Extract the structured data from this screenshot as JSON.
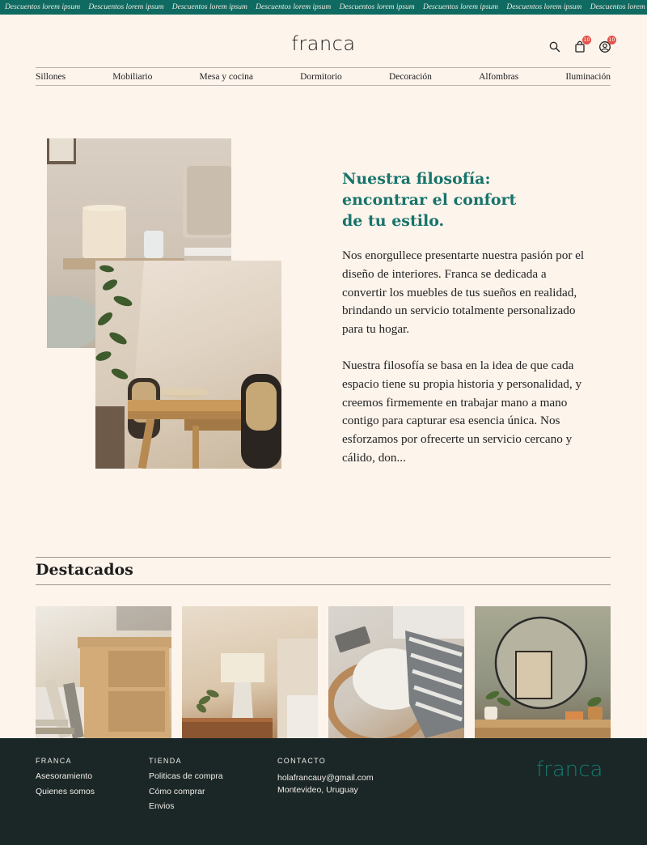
{
  "promo": {
    "text": "Descuentos lorem ipsum",
    "items": [
      "Descuentos lorem ipsum",
      "Descuentos lorem ipsum",
      "Descuentos lorem ipsum",
      "Descuentos lorem ipsum",
      "Descuentos lorem ipsum",
      "Descuentos lorem ipsum",
      "Descuentos lorem ipsum",
      "Descuentos lorem"
    ]
  },
  "header": {
    "logo": "franca",
    "cart_badge": "10",
    "account_badge": "10",
    "icons": [
      "search-icon",
      "shopping-bag-icon",
      "user-icon"
    ]
  },
  "nav": {
    "items": [
      "Sillones",
      "Mobiliario",
      "Mesa y cocina",
      "Dormitorio",
      "Decoración",
      "Alfombras",
      "Iluminación"
    ]
  },
  "philosophy": {
    "title": "Nuestra filosofía:\nencontrar el confort\nde tu estilo.",
    "paragraph1": "Nos enorgullece presentarte nuestra pasión por el diseño de interiores. Franca se dedicada a convertir los muebles de tus sueños en realidad, brindando un servicio totalmente personalizado para tu hogar.",
    "paragraph2": "Nuestra filosofía se basa en la idea de que cada espacio tiene su propia historia y personalidad, y creemos firmemente en trabajar mano a mano contigo para capturar esa esencia única. Nos esforzamos por ofrecerte un servicio cercano y cálido, don..."
  },
  "featured": {
    "title": "Destacados"
  },
  "footer": {
    "col1": {
      "heading": "FRANCA",
      "links": [
        "Asesoramiento",
        "Quienes somos"
      ]
    },
    "col2": {
      "heading": "TIENDA",
      "links": [
        "Politicas de compra",
        "Cómo comprar",
        "Envios"
      ]
    },
    "col3": {
      "heading": "CONTACTO",
      "lines": [
        "holafrancauy@gmail.com",
        "Montevideo, Uruguay"
      ]
    },
    "logo": "franca"
  },
  "colors": {
    "brand_teal": "#0f6b62",
    "title_teal": "#17746b",
    "background": "#fdf4ec",
    "footer_bg": "#1b2727",
    "badge_red": "#e2544a"
  }
}
